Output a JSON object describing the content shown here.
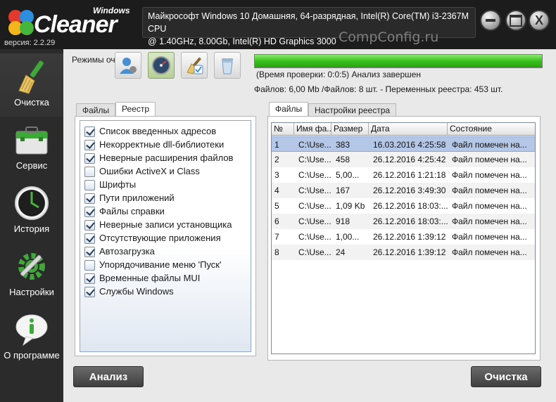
{
  "app": {
    "logo_top": "Windows",
    "logo_main": "Cleaner",
    "version": "версия: 2.2.29",
    "system_info_line1": "Майкрософт Windows 10 Домашняя, 64-разрядная, Intel(R) Core(TM) i3-2367M CPU",
    "system_info_line2": "@ 1.40GHz, 8.00Gb, Intel(R) HD Graphics 3000",
    "watermark": "CompConfig.ru",
    "close_glyph": "X"
  },
  "sidebar": {
    "items": [
      {
        "label": "Очистка",
        "icon": "broom-icon",
        "active": true
      },
      {
        "label": "Сервис",
        "icon": "toolbox-icon",
        "active": false
      },
      {
        "label": "История",
        "icon": "clock-icon",
        "active": false
      },
      {
        "label": "Настройки",
        "icon": "gear-wrench-icon",
        "active": false
      },
      {
        "label": "О программе",
        "icon": "info-bubble-icon",
        "active": false
      }
    ]
  },
  "modes": {
    "label": "Режимы очистки:",
    "buttons": [
      "user-mode-icon",
      "gauge-mode-icon",
      "brush-mode-icon",
      "recycle-bin-mode-icon"
    ],
    "selected_index": 1
  },
  "progress": {
    "value": 1.0,
    "status_line1": "(Время проверки: 0:0:5) Анализ завершен",
    "status_line2": "Файлов: 6,00 Mb /Файлов: 8 шт. - Переменных реестра: 453 шт."
  },
  "left_tabs": {
    "tabs": [
      "Файлы",
      "Реестр"
    ],
    "active": 1
  },
  "registry_items": [
    {
      "label": "Список введенных адресов",
      "checked": true
    },
    {
      "label": "Некорректные dll-библиотеки",
      "checked": true
    },
    {
      "label": "Неверные расширения файлов",
      "checked": true
    },
    {
      "label": "Ошибки ActiveX и Class",
      "checked": false
    },
    {
      "label": "Шрифты",
      "checked": false
    },
    {
      "label": "Пути приложений",
      "checked": true
    },
    {
      "label": "Файлы справки",
      "checked": true
    },
    {
      "label": "Неверные записи установщика",
      "checked": true
    },
    {
      "label": "Отсутствующие приложения",
      "checked": true
    },
    {
      "label": "Автозагрузка",
      "checked": true
    },
    {
      "label": "Упорядочивание меню 'Пуск'",
      "checked": false
    },
    {
      "label": "Временные файлы MUI",
      "checked": true
    },
    {
      "label": "Службы Windows",
      "checked": true
    }
  ],
  "right_tabs": {
    "tabs": [
      "Файлы",
      "Настройки реестра"
    ],
    "active": 0
  },
  "table": {
    "columns": [
      "№",
      "Имя фа...",
      "Размер",
      "Дата",
      "Состояние"
    ],
    "rows": [
      [
        "1",
        "C:\\Use...",
        "383",
        "16.03.2016 4:25:58",
        "Файл помечен на..."
      ],
      [
        "2",
        "C:\\Use...",
        "458",
        "26.12.2016 4:25:42",
        "Файл помечен на..."
      ],
      [
        "3",
        "C:\\Use...",
        "5,00...",
        "26.12.2016 1:21:18",
        "Файл помечен на..."
      ],
      [
        "4",
        "C:\\Use...",
        "167",
        "26.12.2016 3:49:30",
        "Файл помечен на..."
      ],
      [
        "5",
        "C:\\Use...",
        "1,09 Kb",
        "26.12.2016 18:03:...",
        "Файл помечен на..."
      ],
      [
        "6",
        "C:\\Use...",
        "918",
        "26.12.2016 18:03:...",
        "Файл помечен на..."
      ],
      [
        "7",
        "C:\\Use...",
        "1,00...",
        "26.12.2016 1:39:12",
        "Файл помечен на..."
      ],
      [
        "8",
        "C:\\Use...",
        "24",
        "26.12.2016 1:39:12",
        "Файл помечен на..."
      ]
    ],
    "selected_row": 0
  },
  "buttons": {
    "analyze": "Анализ",
    "clean": "Очистка"
  },
  "colors": {
    "progress": "#37c21d",
    "selection": "#b4c7e6"
  }
}
